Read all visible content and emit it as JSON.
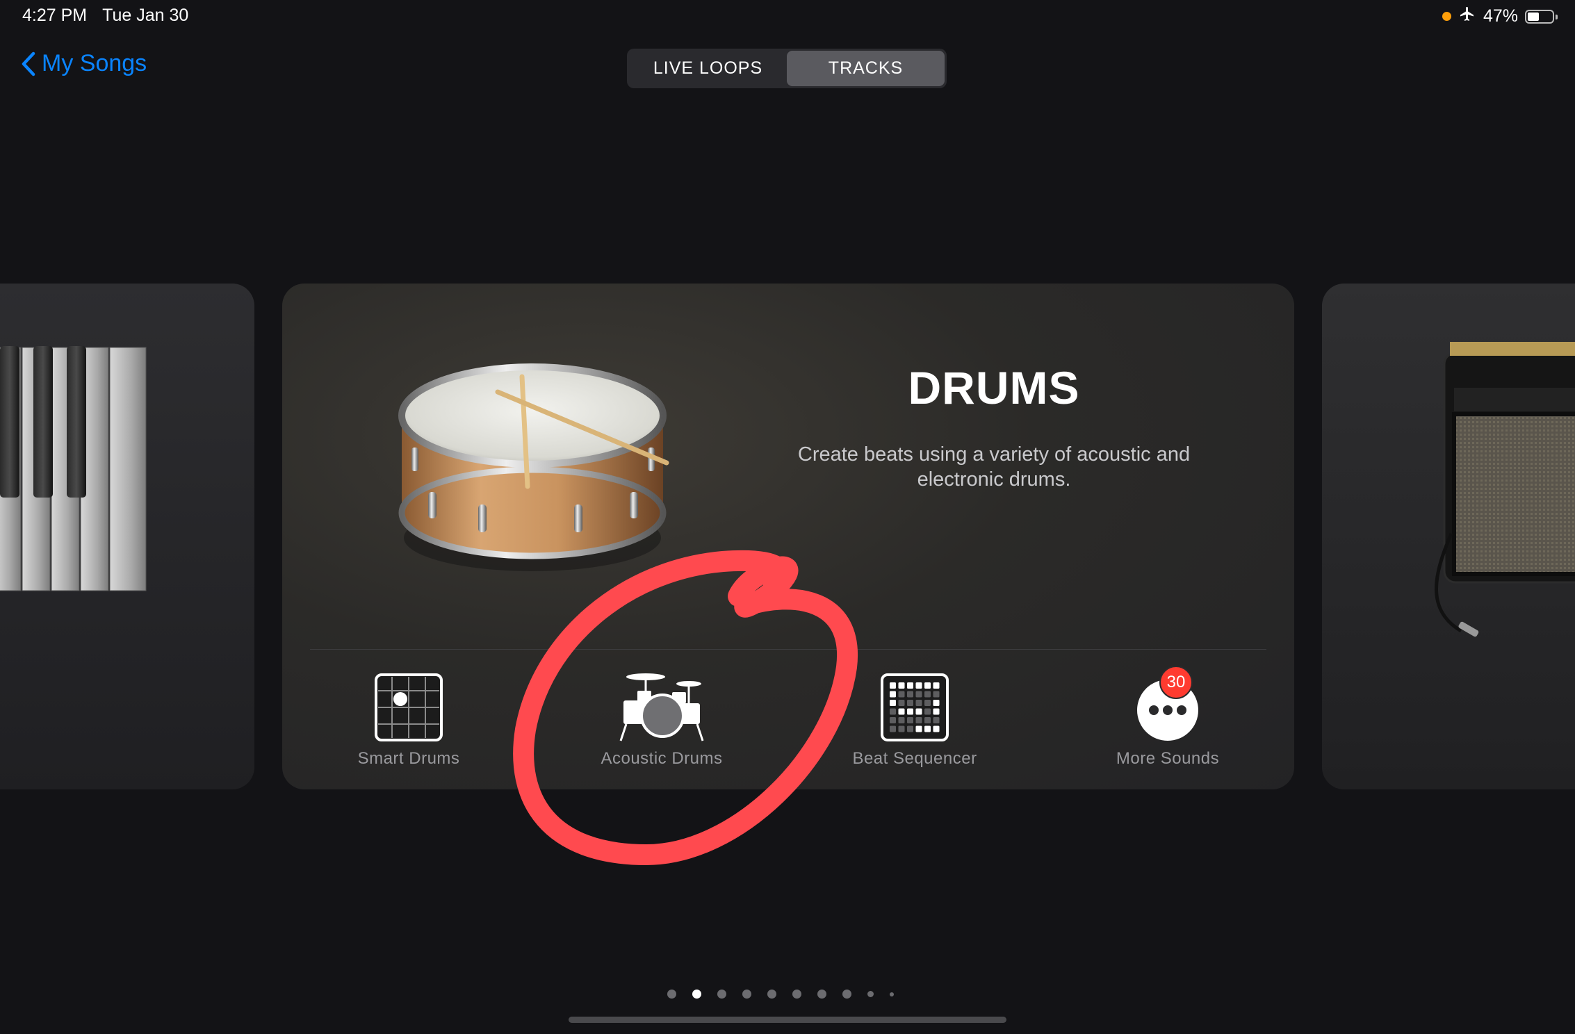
{
  "status_bar": {
    "time": "4:27 PM",
    "date": "Tue Jan 30",
    "battery_percent": "47%",
    "battery_level": 0.47
  },
  "nav": {
    "back_label": "My Songs",
    "tabs": [
      {
        "label": "LIVE LOOPS",
        "active": false
      },
      {
        "label": "TRACKS",
        "active": true
      }
    ]
  },
  "instrument": {
    "title": "DRUMS",
    "description": "Create beats using a variety of acoustic and electronic drums.",
    "options": [
      {
        "label": "Smart Drums",
        "icon": "smart-drums-grid-icon"
      },
      {
        "label": "Acoustic Drums",
        "icon": "drum-kit-icon"
      },
      {
        "label": "Beat Sequencer",
        "icon": "beat-sequencer-icon"
      },
      {
        "label": "More Sounds",
        "icon": "more-icon",
        "badge": "30"
      }
    ]
  },
  "pager": {
    "count": 10,
    "active_index": 1
  },
  "colors": {
    "accent": "#0a84ff",
    "badge": "#ff3b30",
    "annotation": "#ff4a4f"
  }
}
